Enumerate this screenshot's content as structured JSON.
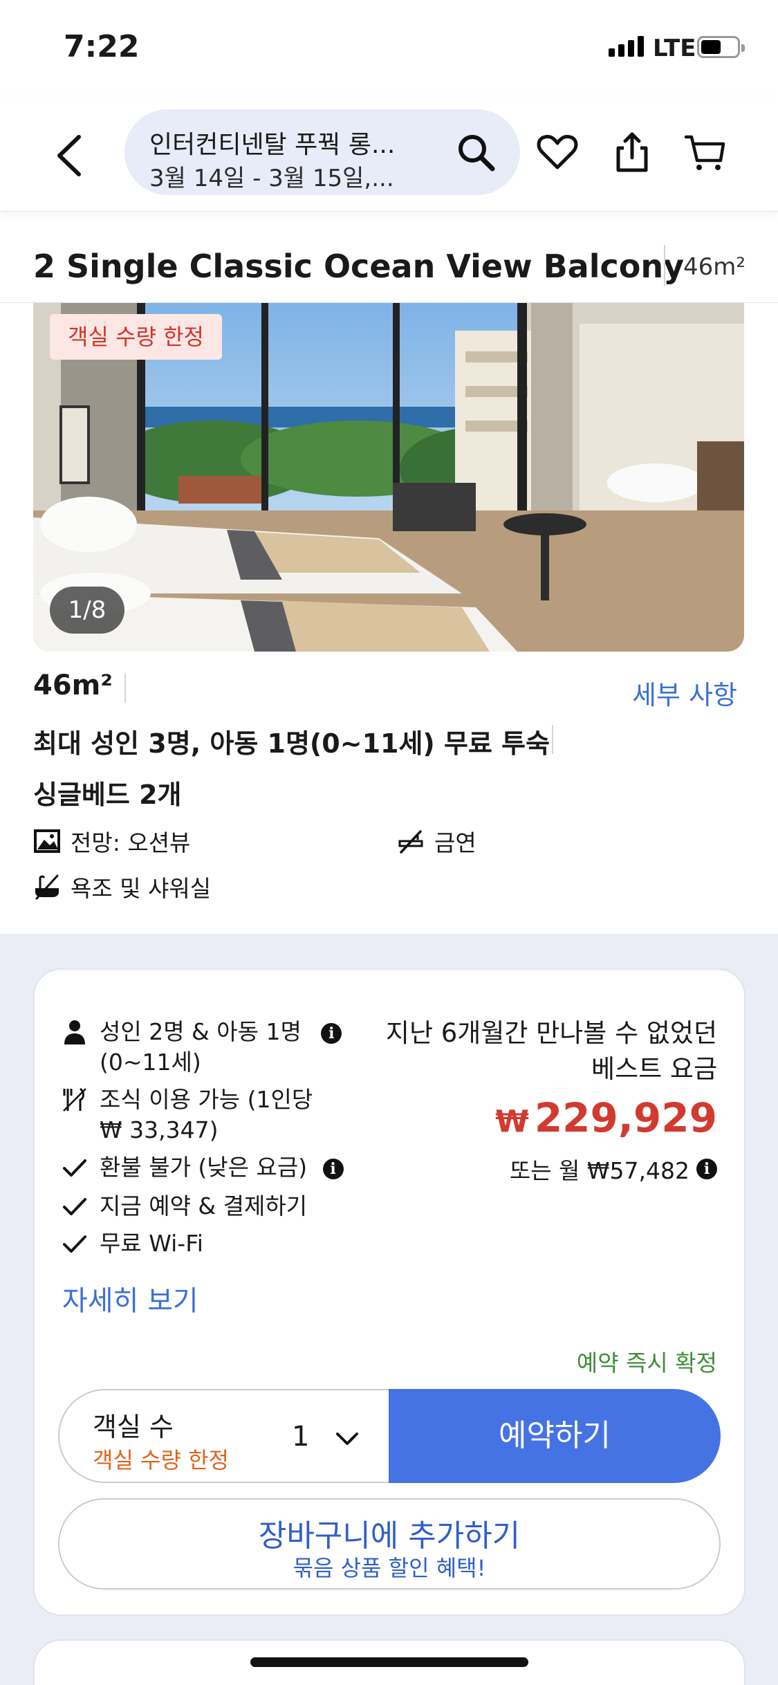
{
  "status_bar": {
    "time": "7:22",
    "network": "LTE"
  },
  "header": {
    "hotel_name": "인터컨티넨탈 푸꿕 롱...",
    "dates": "3월 14일 - 3월 15일,..."
  },
  "room": {
    "title": "2 Single Classic Ocean View Balcony",
    "size": "46m²",
    "photo_badge": "객실 수량 한정",
    "photo_counter": "1/8",
    "details_link": "세부 사항",
    "occupancy": "최대 성인 3명, 아동 1명(0~11세) 무료 투숙",
    "beds": "싱글베드 2개",
    "features": {
      "view": "전망: 오션뷰",
      "smoking": "금연",
      "bath": "욕조 및 샤워실"
    }
  },
  "offer": {
    "guests": "성인 2명 & 아동 1명",
    "guests_line2": "(0~11세)",
    "breakfast": "조식 이용 가능 (1인당",
    "breakfast_line2": "₩ 33,347)",
    "refund": "환불 불가 (낮은 요금)",
    "pay_now": "지금 예약 & 결제하기",
    "wifi": "무료 Wi-Fi",
    "more_link": "자세히 보기",
    "best_rate_line1": "지난 6개월간 만나볼 수 없었던",
    "best_rate_line2": "베스트 요금",
    "currency_symbol": "₩",
    "price": "229,929",
    "monthly": "또는 월 ₩57,482",
    "instant_confirm": "예약 즉시 확정",
    "rooms_label": "객실 수",
    "rooms_limited": "객실 수량 한정",
    "rooms_value": "1",
    "book_button": "예약하기",
    "cart_button": "장바구니에 추가하기",
    "cart_sub": "묶음 상품 할인 혜택!"
  },
  "colors": {
    "accent_blue": "#4673e4",
    "link_blue": "#3b6fd8",
    "price_red": "#d23a2f",
    "confirm_green": "#3d8f3a",
    "limited_orange": "#e0641c"
  }
}
